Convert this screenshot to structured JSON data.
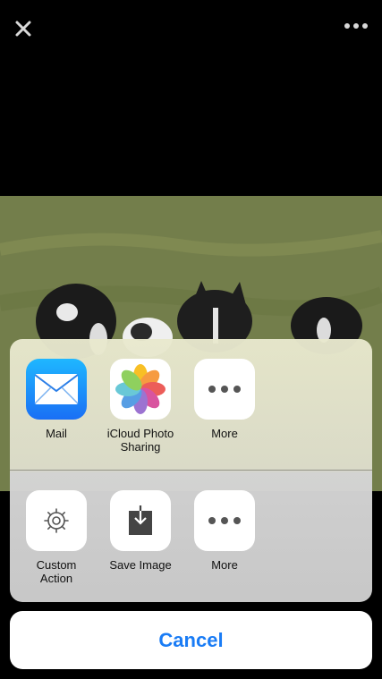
{
  "topbar": {
    "close_icon": "close-icon",
    "more_icon": "ellipsis-icon"
  },
  "share_row": [
    {
      "label": "Mail",
      "icon": "mail-icon"
    },
    {
      "label": "iCloud Photo\nSharing",
      "icon": "photos-icon"
    },
    {
      "label": "More",
      "icon": "ellipsis-icon"
    }
  ],
  "action_row": [
    {
      "label": "Custom\nAction",
      "icon": "gear-icon"
    },
    {
      "label": "Save Image",
      "icon": "save-image-icon"
    },
    {
      "label": "More",
      "icon": "ellipsis-icon"
    }
  ],
  "cancel_label": "Cancel",
  "colors": {
    "accent": "#1a7cf5",
    "mail_top": "#1fb7ff",
    "mail_bottom": "#1a6ff5"
  }
}
